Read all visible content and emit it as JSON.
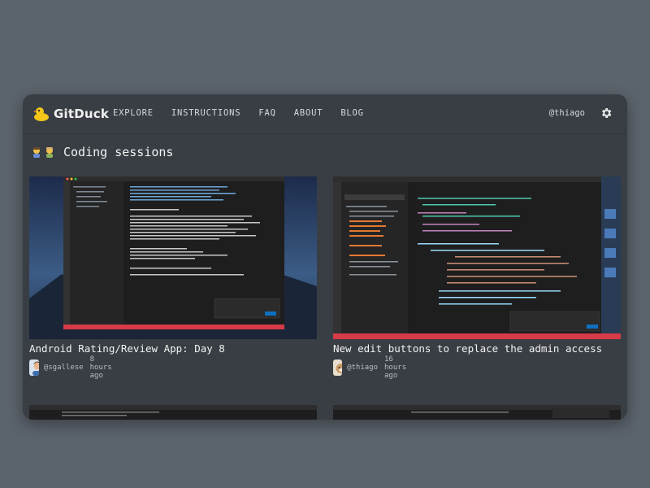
{
  "app": {
    "brand": "GitDuck",
    "accent": "#f5c518"
  },
  "nav": {
    "items": [
      "EXPLORE",
      "INSTRUCTIONS",
      "FAQ",
      "ABOUT",
      "BLOG"
    ]
  },
  "user": {
    "handle": "@thiago"
  },
  "section": {
    "title": "Coding sessions"
  },
  "cards": [
    {
      "title": "Android Rating/Review App: Day 8",
      "author": "@sgallese",
      "time": "8 hours ago"
    },
    {
      "title": "New edit buttons to replace the admin access",
      "author": "@thiago",
      "time": "16 hours ago"
    }
  ],
  "colors": {
    "background": "#5b636b",
    "panel": "#393e44",
    "editor": "#1e1e1e",
    "statusbar": "#d73a49"
  },
  "icons": [
    "gitduck-logo-icon",
    "gear-icon",
    "people-emoji-icon"
  ]
}
